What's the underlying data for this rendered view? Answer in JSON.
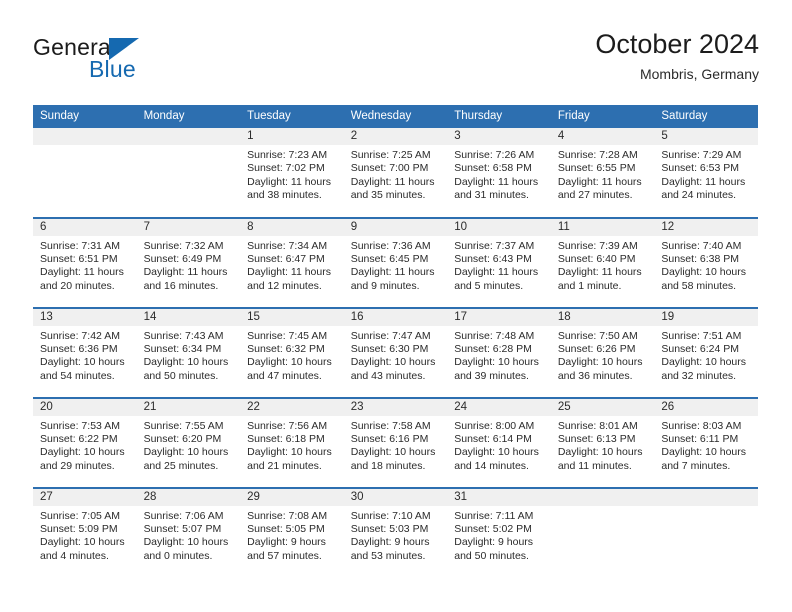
{
  "logo": {
    "word_top": "General",
    "word_bottom": "Blue",
    "triangle_color": "#1569b0",
    "text_color": "#1b1b1b"
  },
  "header": {
    "title": "October 2024",
    "subtitle": "Mombris, Germany"
  },
  "theme": {
    "header_blue": "#2d6fb0",
    "daynum_band": "#f0f0f0",
    "text": "#2b2b2b"
  },
  "weekday_headers": [
    "Sunday",
    "Monday",
    "Tuesday",
    "Wednesday",
    "Thursday",
    "Friday",
    "Saturday"
  ],
  "labels": {
    "sunrise_prefix": "Sunrise:",
    "sunset_prefix": "Sunset:",
    "daylight_prefix": "Daylight:"
  },
  "weeks": [
    [
      {
        "empty": true
      },
      {
        "empty": true
      },
      {
        "day": "1",
        "sunrise": "Sunrise: 7:23 AM",
        "sunset": "Sunset: 7:02 PM",
        "daylight_l1": "Daylight: 11 hours",
        "daylight_l2": "and 38 minutes."
      },
      {
        "day": "2",
        "sunrise": "Sunrise: 7:25 AM",
        "sunset": "Sunset: 7:00 PM",
        "daylight_l1": "Daylight: 11 hours",
        "daylight_l2": "and 35 minutes."
      },
      {
        "day": "3",
        "sunrise": "Sunrise: 7:26 AM",
        "sunset": "Sunset: 6:58 PM",
        "daylight_l1": "Daylight: 11 hours",
        "daylight_l2": "and 31 minutes."
      },
      {
        "day": "4",
        "sunrise": "Sunrise: 7:28 AM",
        "sunset": "Sunset: 6:55 PM",
        "daylight_l1": "Daylight: 11 hours",
        "daylight_l2": "and 27 minutes."
      },
      {
        "day": "5",
        "sunrise": "Sunrise: 7:29 AM",
        "sunset": "Sunset: 6:53 PM",
        "daylight_l1": "Daylight: 11 hours",
        "daylight_l2": "and 24 minutes."
      }
    ],
    [
      {
        "day": "6",
        "sunrise": "Sunrise: 7:31 AM",
        "sunset": "Sunset: 6:51 PM",
        "daylight_l1": "Daylight: 11 hours",
        "daylight_l2": "and 20 minutes."
      },
      {
        "day": "7",
        "sunrise": "Sunrise: 7:32 AM",
        "sunset": "Sunset: 6:49 PM",
        "daylight_l1": "Daylight: 11 hours",
        "daylight_l2": "and 16 minutes."
      },
      {
        "day": "8",
        "sunrise": "Sunrise: 7:34 AM",
        "sunset": "Sunset: 6:47 PM",
        "daylight_l1": "Daylight: 11 hours",
        "daylight_l2": "and 12 minutes."
      },
      {
        "day": "9",
        "sunrise": "Sunrise: 7:36 AM",
        "sunset": "Sunset: 6:45 PM",
        "daylight_l1": "Daylight: 11 hours",
        "daylight_l2": "and 9 minutes."
      },
      {
        "day": "10",
        "sunrise": "Sunrise: 7:37 AM",
        "sunset": "Sunset: 6:43 PM",
        "daylight_l1": "Daylight: 11 hours",
        "daylight_l2": "and 5 minutes."
      },
      {
        "day": "11",
        "sunrise": "Sunrise: 7:39 AM",
        "sunset": "Sunset: 6:40 PM",
        "daylight_l1": "Daylight: 11 hours",
        "daylight_l2": "and 1 minute."
      },
      {
        "day": "12",
        "sunrise": "Sunrise: 7:40 AM",
        "sunset": "Sunset: 6:38 PM",
        "daylight_l1": "Daylight: 10 hours",
        "daylight_l2": "and 58 minutes."
      }
    ],
    [
      {
        "day": "13",
        "sunrise": "Sunrise: 7:42 AM",
        "sunset": "Sunset: 6:36 PM",
        "daylight_l1": "Daylight: 10 hours",
        "daylight_l2": "and 54 minutes."
      },
      {
        "day": "14",
        "sunrise": "Sunrise: 7:43 AM",
        "sunset": "Sunset: 6:34 PM",
        "daylight_l1": "Daylight: 10 hours",
        "daylight_l2": "and 50 minutes."
      },
      {
        "day": "15",
        "sunrise": "Sunrise: 7:45 AM",
        "sunset": "Sunset: 6:32 PM",
        "daylight_l1": "Daylight: 10 hours",
        "daylight_l2": "and 47 minutes."
      },
      {
        "day": "16",
        "sunrise": "Sunrise: 7:47 AM",
        "sunset": "Sunset: 6:30 PM",
        "daylight_l1": "Daylight: 10 hours",
        "daylight_l2": "and 43 minutes."
      },
      {
        "day": "17",
        "sunrise": "Sunrise: 7:48 AM",
        "sunset": "Sunset: 6:28 PM",
        "daylight_l1": "Daylight: 10 hours",
        "daylight_l2": "and 39 minutes."
      },
      {
        "day": "18",
        "sunrise": "Sunrise: 7:50 AM",
        "sunset": "Sunset: 6:26 PM",
        "daylight_l1": "Daylight: 10 hours",
        "daylight_l2": "and 36 minutes."
      },
      {
        "day": "19",
        "sunrise": "Sunrise: 7:51 AM",
        "sunset": "Sunset: 6:24 PM",
        "daylight_l1": "Daylight: 10 hours",
        "daylight_l2": "and 32 minutes."
      }
    ],
    [
      {
        "day": "20",
        "sunrise": "Sunrise: 7:53 AM",
        "sunset": "Sunset: 6:22 PM",
        "daylight_l1": "Daylight: 10 hours",
        "daylight_l2": "and 29 minutes."
      },
      {
        "day": "21",
        "sunrise": "Sunrise: 7:55 AM",
        "sunset": "Sunset: 6:20 PM",
        "daylight_l1": "Daylight: 10 hours",
        "daylight_l2": "and 25 minutes."
      },
      {
        "day": "22",
        "sunrise": "Sunrise: 7:56 AM",
        "sunset": "Sunset: 6:18 PM",
        "daylight_l1": "Daylight: 10 hours",
        "daylight_l2": "and 21 minutes."
      },
      {
        "day": "23",
        "sunrise": "Sunrise: 7:58 AM",
        "sunset": "Sunset: 6:16 PM",
        "daylight_l1": "Daylight: 10 hours",
        "daylight_l2": "and 18 minutes."
      },
      {
        "day": "24",
        "sunrise": "Sunrise: 8:00 AM",
        "sunset": "Sunset: 6:14 PM",
        "daylight_l1": "Daylight: 10 hours",
        "daylight_l2": "and 14 minutes."
      },
      {
        "day": "25",
        "sunrise": "Sunrise: 8:01 AM",
        "sunset": "Sunset: 6:13 PM",
        "daylight_l1": "Daylight: 10 hours",
        "daylight_l2": "and 11 minutes."
      },
      {
        "day": "26",
        "sunrise": "Sunrise: 8:03 AM",
        "sunset": "Sunset: 6:11 PM",
        "daylight_l1": "Daylight: 10 hours",
        "daylight_l2": "and 7 minutes."
      }
    ],
    [
      {
        "day": "27",
        "sunrise": "Sunrise: 7:05 AM",
        "sunset": "Sunset: 5:09 PM",
        "daylight_l1": "Daylight: 10 hours",
        "daylight_l2": "and 4 minutes."
      },
      {
        "day": "28",
        "sunrise": "Sunrise: 7:06 AM",
        "sunset": "Sunset: 5:07 PM",
        "daylight_l1": "Daylight: 10 hours",
        "daylight_l2": "and 0 minutes."
      },
      {
        "day": "29",
        "sunrise": "Sunrise: 7:08 AM",
        "sunset": "Sunset: 5:05 PM",
        "daylight_l1": "Daylight: 9 hours",
        "daylight_l2": "and 57 minutes."
      },
      {
        "day": "30",
        "sunrise": "Sunrise: 7:10 AM",
        "sunset": "Sunset: 5:03 PM",
        "daylight_l1": "Daylight: 9 hours",
        "daylight_l2": "and 53 minutes."
      },
      {
        "day": "31",
        "sunrise": "Sunrise: 7:11 AM",
        "sunset": "Sunset: 5:02 PM",
        "daylight_l1": "Daylight: 9 hours",
        "daylight_l2": "and 50 minutes."
      },
      {
        "empty": true
      },
      {
        "empty": true
      }
    ]
  ]
}
